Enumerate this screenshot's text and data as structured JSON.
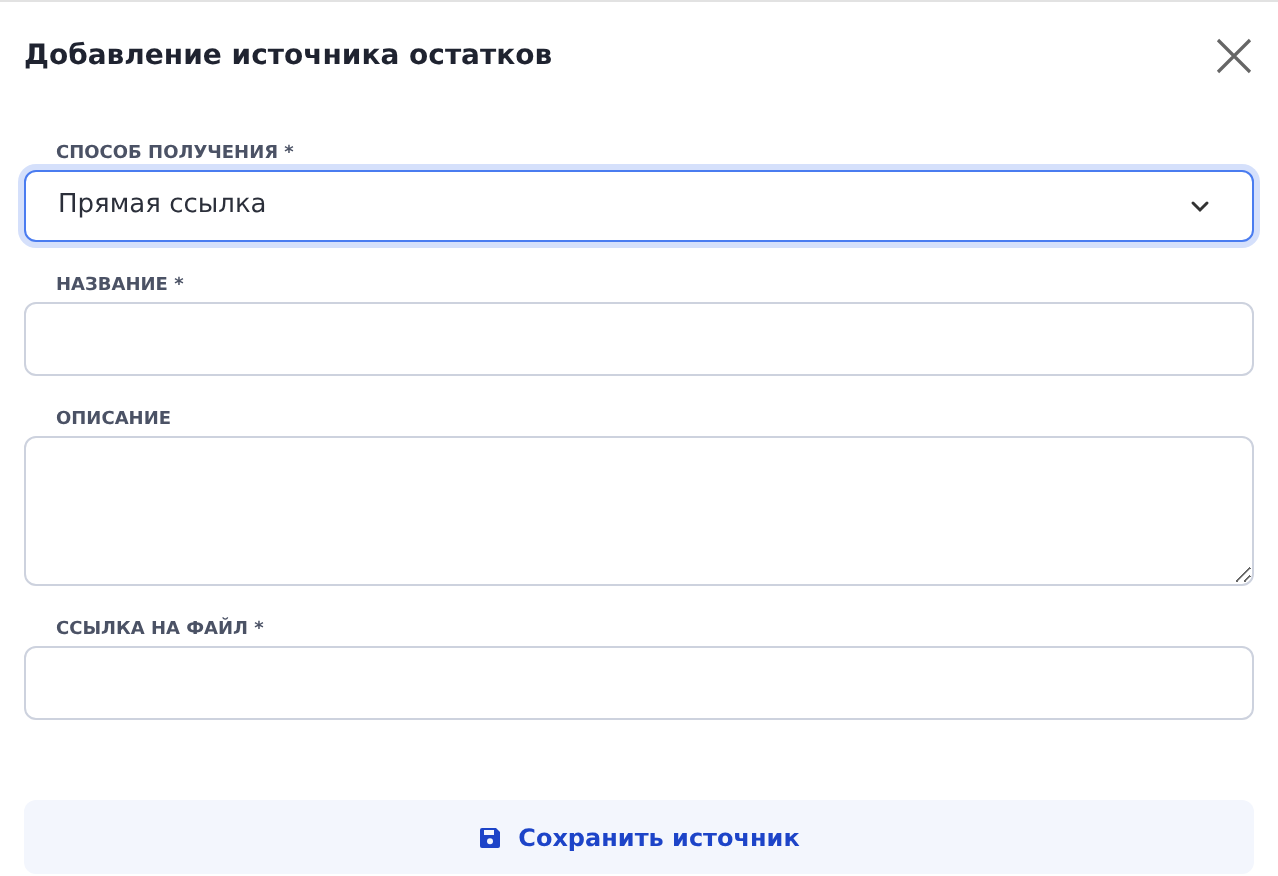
{
  "dialog": {
    "title": "Добавление источника остатков"
  },
  "fields": [
    {
      "kind": "select",
      "label": "СПОСОБ ПОЛУЧЕНИЯ *",
      "value": "Прямая ссылка",
      "focused": true
    },
    {
      "kind": "input",
      "label": "НАЗВАНИЕ *",
      "focused": false
    },
    {
      "kind": "textarea",
      "label": "ОПИСАНИЕ",
      "focused": false
    },
    {
      "kind": "input",
      "label": "ССЫЛКА НА ФАЙЛ *",
      "focused": false
    }
  ],
  "save_button": {
    "label": "Сохранить источник"
  }
}
